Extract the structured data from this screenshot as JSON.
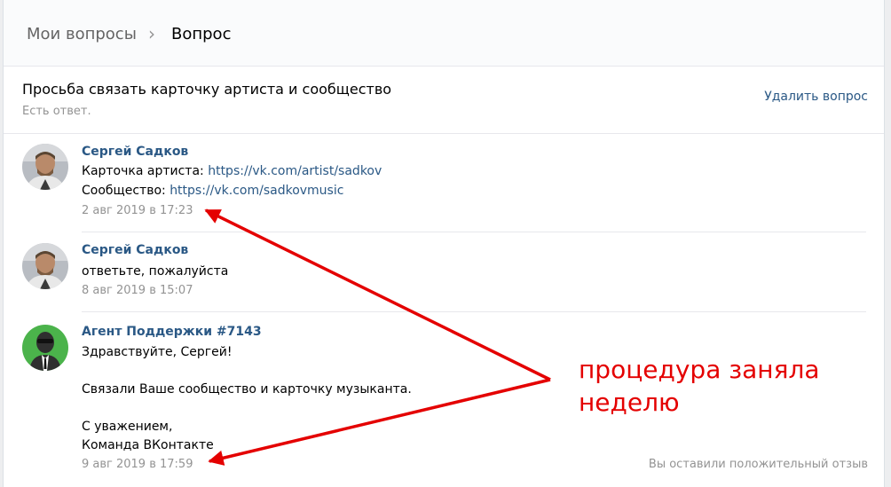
{
  "breadcrumb": {
    "parent": "Мои вопросы",
    "separator": "›",
    "current": "Вопрос"
  },
  "question": {
    "title": "Просьба связать карточку артиста и сообщество",
    "status": "Есть ответ.",
    "delete_label": "Удалить вопрос"
  },
  "messages": [
    {
      "author": "Сергей Садков",
      "line1_prefix": "Карточка артиста: ",
      "line1_link": "https://vk.com/artist/sadkov",
      "line2_prefix": "Сообщество: ",
      "line2_link": "https://vk.com/sadkovmusic",
      "date": "2 авг 2019 в 17:23"
    },
    {
      "author": "Сергей Садков",
      "text": "ответьте, пожалуйста",
      "date": "8 авг 2019 в 15:07"
    },
    {
      "author": "Агент Поддержки #7143",
      "greeting": "Здравствуйте, Сергей!",
      "body": "Связали Ваше сообщество и карточку музыканта.",
      "sign1": "С уважением,",
      "sign2": "Команда ВКонтакте",
      "date": "9 авг 2019 в 17:59",
      "feedback": "Вы оставили положительный отзыв"
    }
  ],
  "annotation": {
    "line1": "процедура заняла",
    "line2": "неделю",
    "color": "#e40000"
  },
  "colors": {
    "link": "#2a5885",
    "muted": "#939393",
    "agent_avatar": "#4bb34b"
  }
}
